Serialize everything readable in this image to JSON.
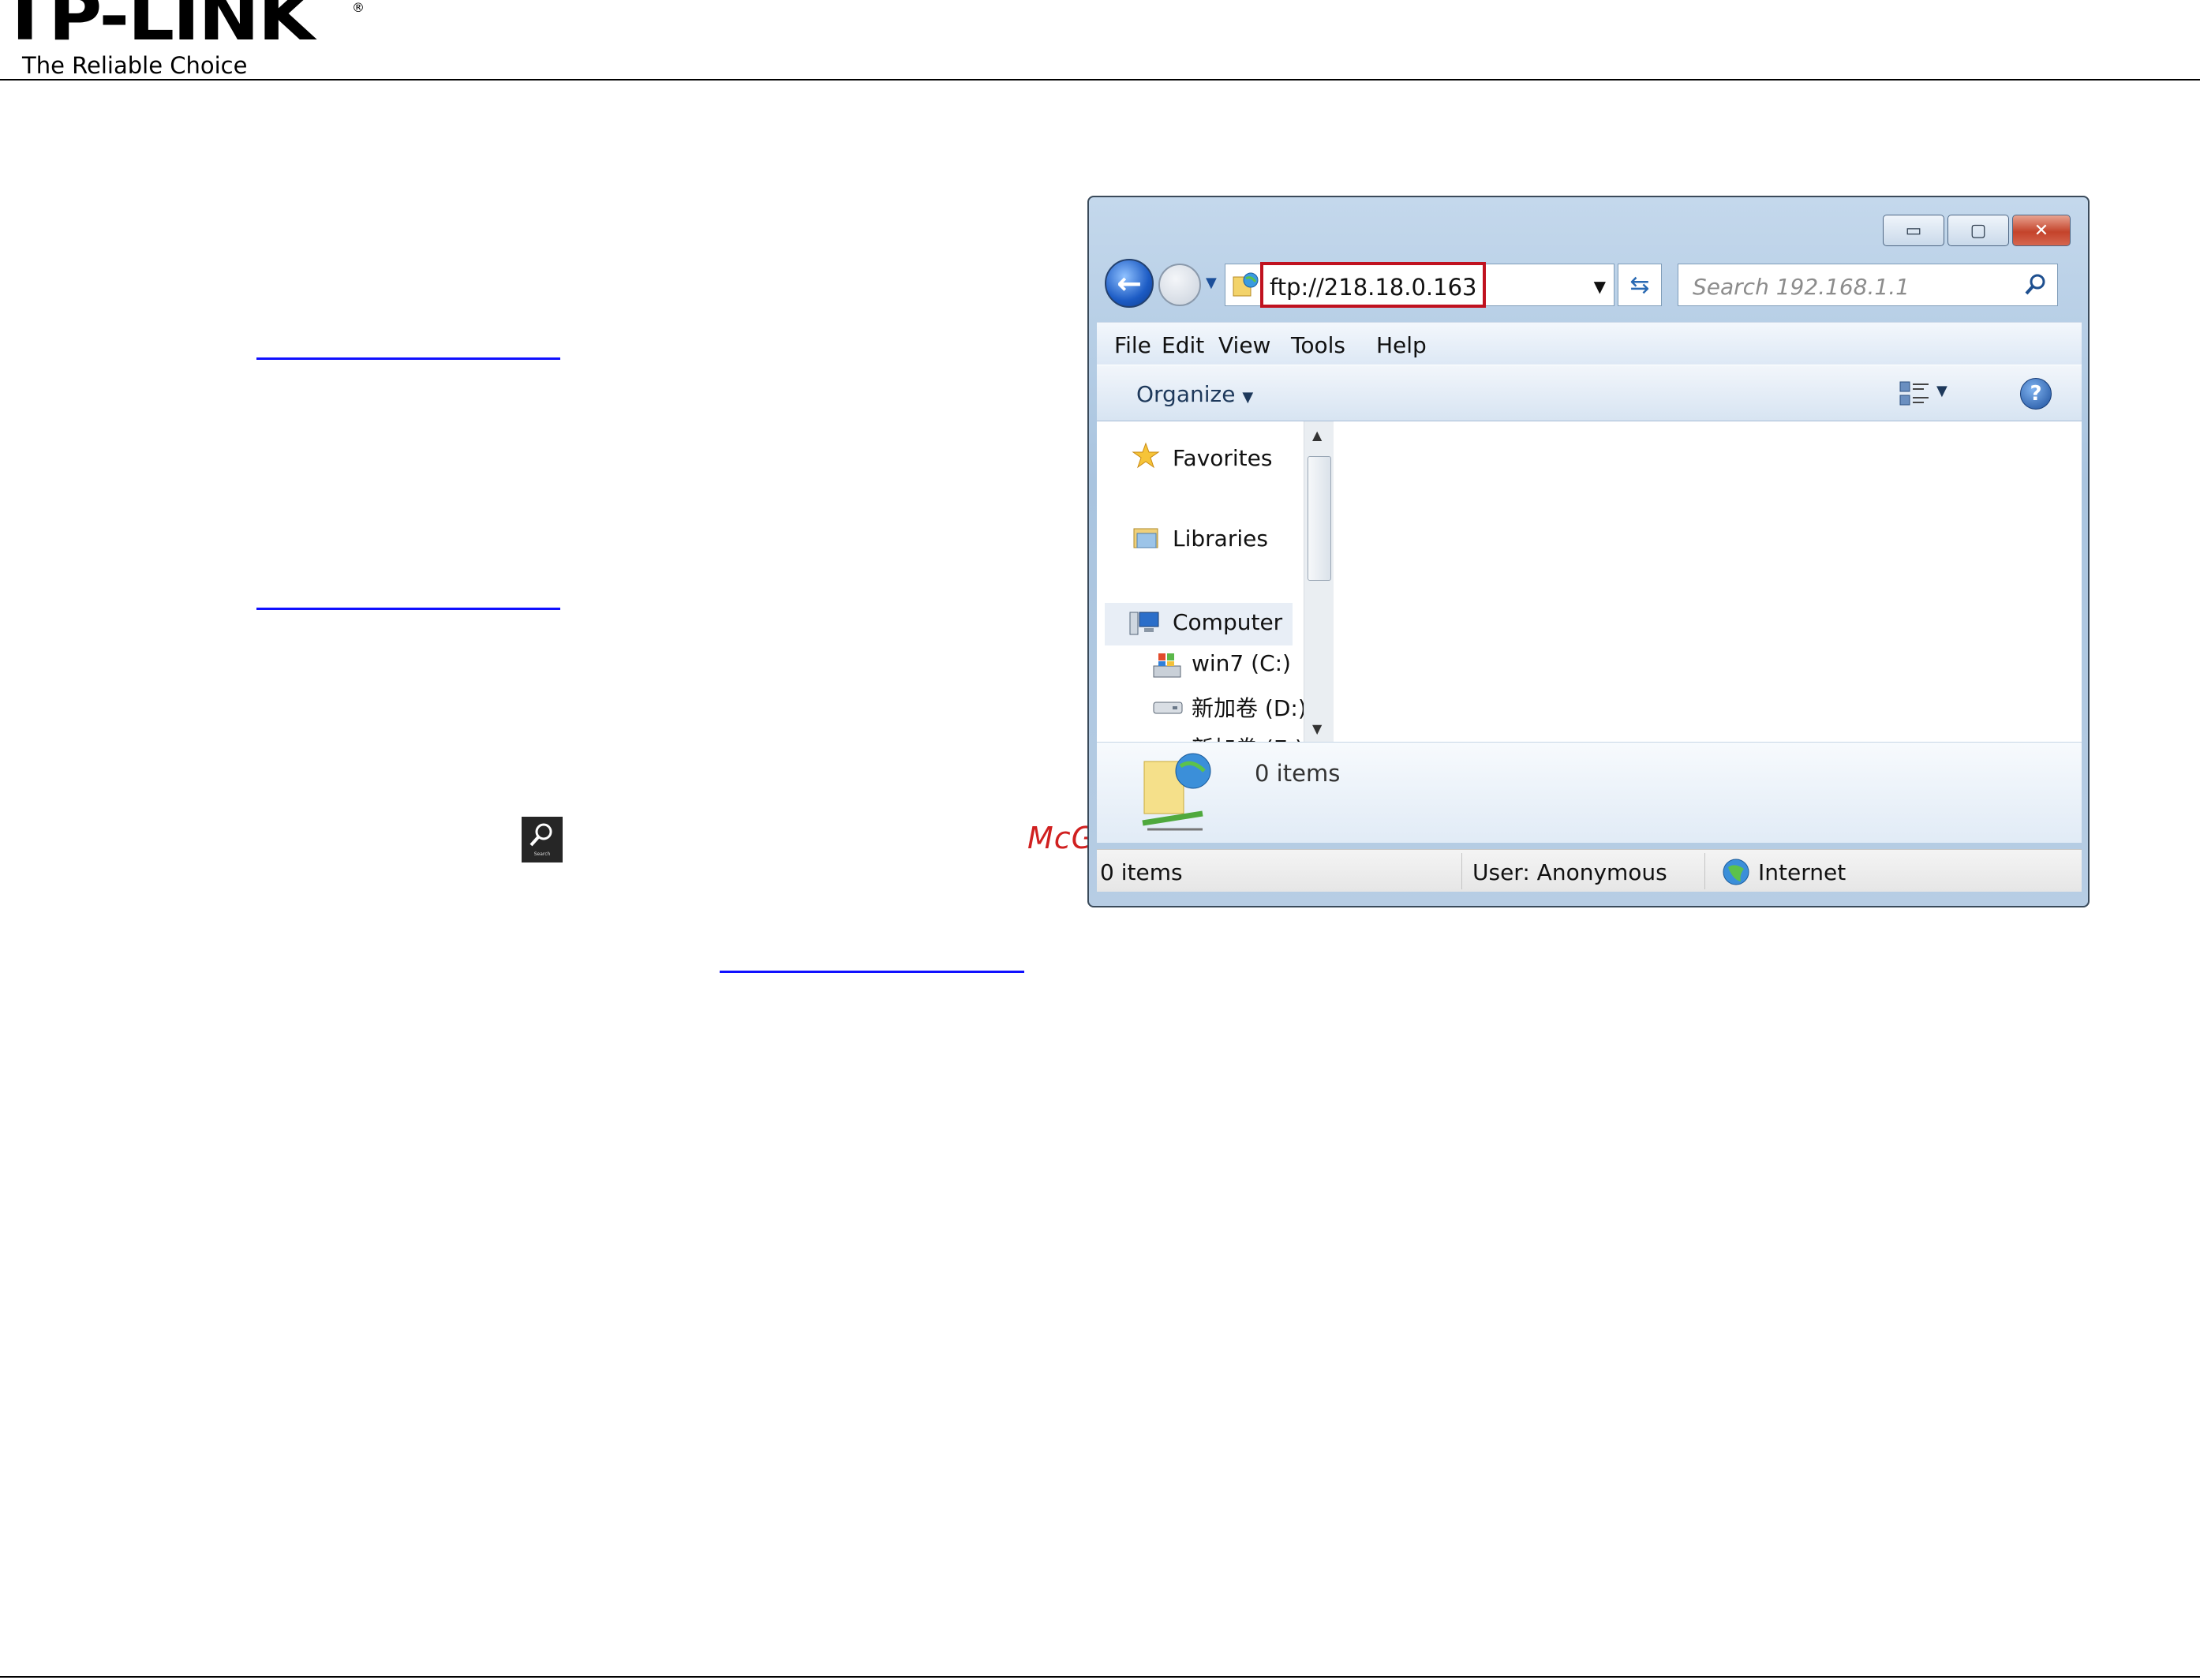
{
  "header": {
    "logo": "TP-LINK",
    "registered": "®",
    "tagline": "The Reliable Choice"
  },
  "watermark": "McGrp.Ru",
  "charm": {
    "icon": "search-icon",
    "caption": "Search"
  },
  "explorer": {
    "address": "ftp://218.18.0.163",
    "search_placeholder": "Search 192.168.1.1",
    "menu": [
      "File",
      "Edit",
      "View",
      "Tools",
      "Help"
    ],
    "organize_label": "Organize",
    "nav": {
      "favorites": "Favorites",
      "libraries": "Libraries",
      "computer": "Computer",
      "drive_c": "win7 (C:)",
      "drive_d": "新加卷 (D:)",
      "drive_e": "新加卷 (E:)"
    },
    "details_count": "0 items",
    "status": {
      "items": "0 items",
      "user": "User: Anonymous",
      "zone": "Internet"
    },
    "colors": {
      "highlight_box": "#c0121f",
      "link_blue": "#1010ff"
    }
  }
}
